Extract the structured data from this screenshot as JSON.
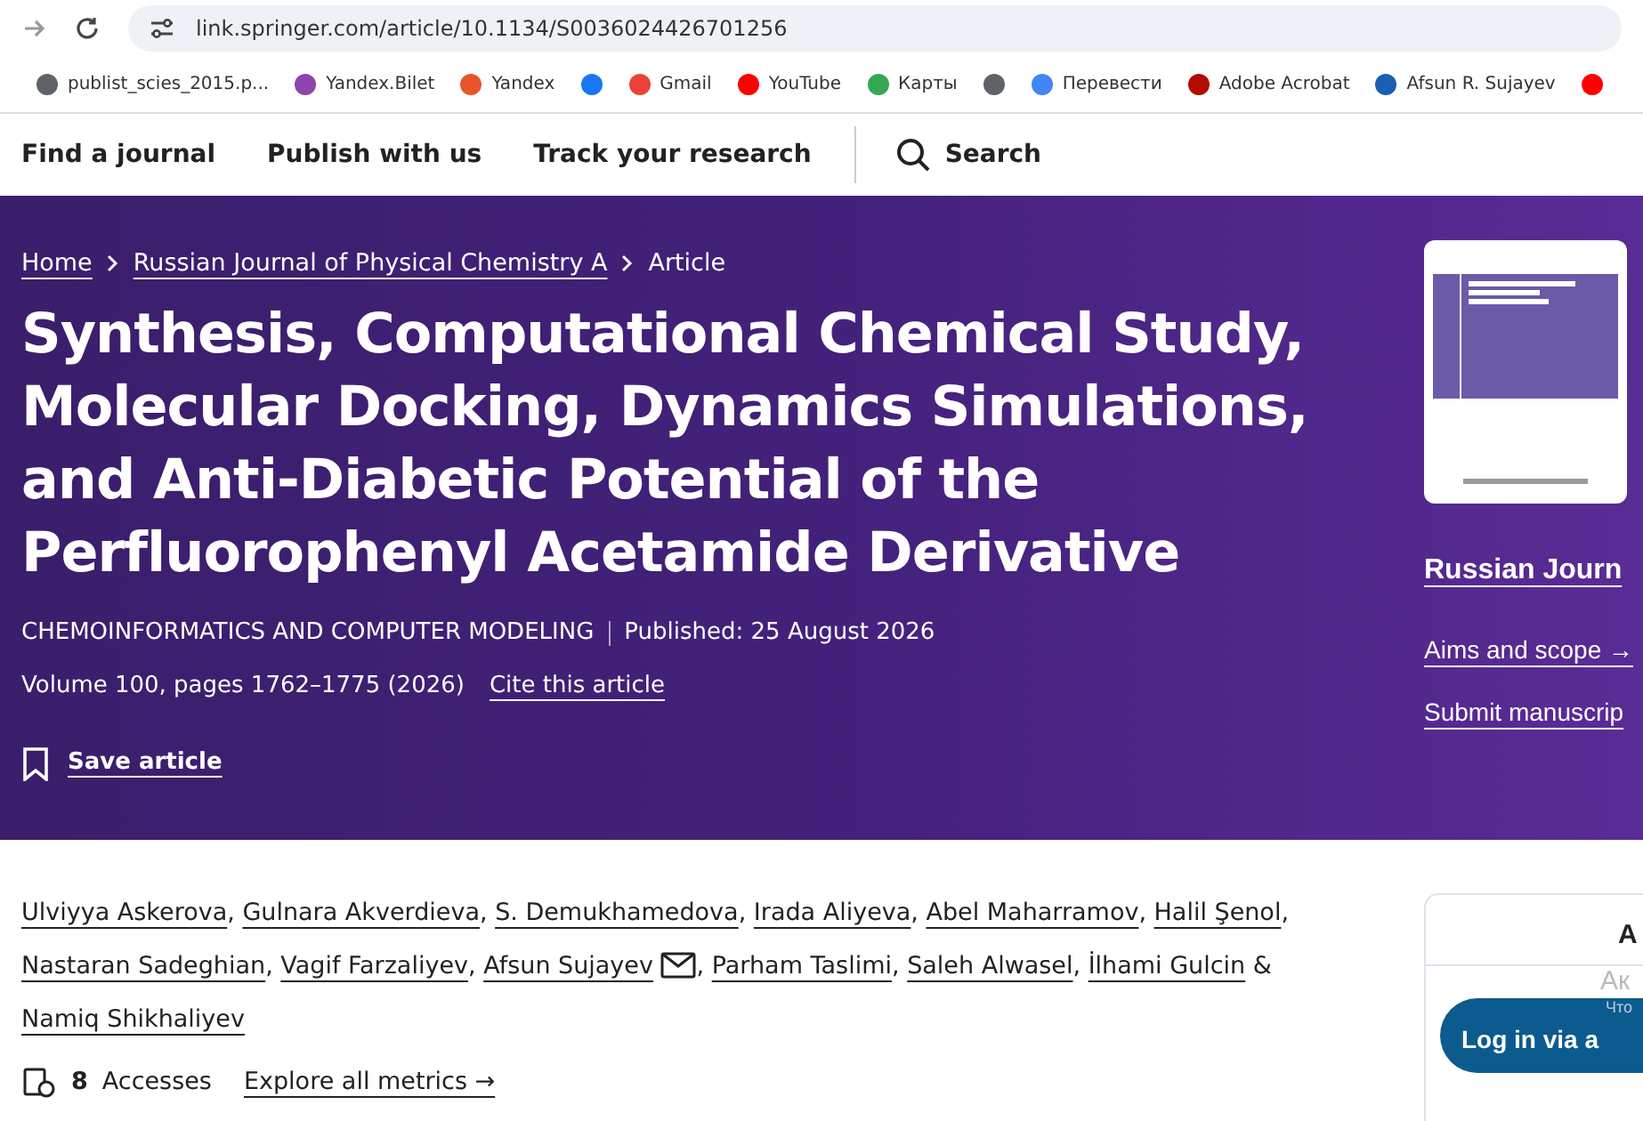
{
  "browser": {
    "url": "link.springer.com/article/10.1134/S0036024426701256"
  },
  "bookmarks": [
    {
      "label": "publist_scies_2015.p...",
      "color": "#5f6368"
    },
    {
      "label": "Yandex.Bilet",
      "color": "#8e44ad"
    },
    {
      "label": "Yandex",
      "color": "#e8552d"
    },
    {
      "color": "#1877f2"
    },
    {
      "label": "Gmail",
      "color": "#ea4335"
    },
    {
      "label": "YouTube",
      "color": "#ff0000"
    },
    {
      "label": "Карты",
      "color": "#34a853"
    },
    {
      "color": "#5f6368"
    },
    {
      "label": "Перевести",
      "color": "#4285f4"
    },
    {
      "label": "Adobe Acrobat",
      "color": "#b30b00"
    },
    {
      "label": "Afsun R. Sujayev",
      "color": "#1a5fb4"
    },
    {
      "color": "#ff0000"
    }
  ],
  "nav": {
    "items": [
      "Find a journal",
      "Publish with us",
      "Track your research"
    ],
    "search": "Search"
  },
  "breadcrumbs": [
    "Home",
    "Russian Journal of Physical Chemistry A",
    "Article"
  ],
  "article": {
    "title": "Synthesis, Computational Chemical Study, Molecular Docking, Dynamics Simulations, and Anti-Diabetic Potential of the Perfluorophenyl Acetamide Derivative",
    "section": "CHEMOINFORMATICS AND COMPUTER MODELING",
    "published": "Published: 25 August 2026",
    "citation": "Volume 100, pages 1762–1775 (2026)",
    "cite_link": "Cite this article",
    "save": "Save article"
  },
  "journal_panel": {
    "name": "Russian Journ",
    "links": [
      "Aims and scope →",
      "Submit manuscrip"
    ]
  },
  "authors": [
    {
      "name": "Ulviyya Askerova",
      "sep": ",",
      "email": false
    },
    {
      "name": "Gulnara Akverdieva",
      "sep": ",",
      "email": false
    },
    {
      "name": "S. Demukhamedova",
      "sep": ",",
      "email": false
    },
    {
      "name": "Irada Aliyeva",
      "sep": ",",
      "email": false
    },
    {
      "name": "Abel Maharramov",
      "sep": ",",
      "email": false
    },
    {
      "name": "Halil Şenol",
      "sep": ",",
      "email": false
    },
    {
      "name": "Nastaran Sadeghian",
      "sep": ",",
      "email": false
    },
    {
      "name": "Vagif Farzaliyev",
      "sep": ",",
      "email": false
    },
    {
      "name": "Afsun Sujayev",
      "sep": ",",
      "email": true
    },
    {
      "name": "Parham Taslimi",
      "sep": ",",
      "email": false
    },
    {
      "name": "Saleh Alwasel",
      "sep": ",",
      "email": false
    },
    {
      "name": "İlhami Gulcin",
      "sep": " &",
      "email": false
    },
    {
      "name": "Namiq Shikhaliyev",
      "email": false
    }
  ],
  "metrics": {
    "count": "8",
    "label": "Accesses",
    "link": "Explore all metrics →"
  },
  "access_card": {
    "heading": "A",
    "subheading": "Ак",
    "hint": "Что",
    "button": "Log in via a"
  }
}
